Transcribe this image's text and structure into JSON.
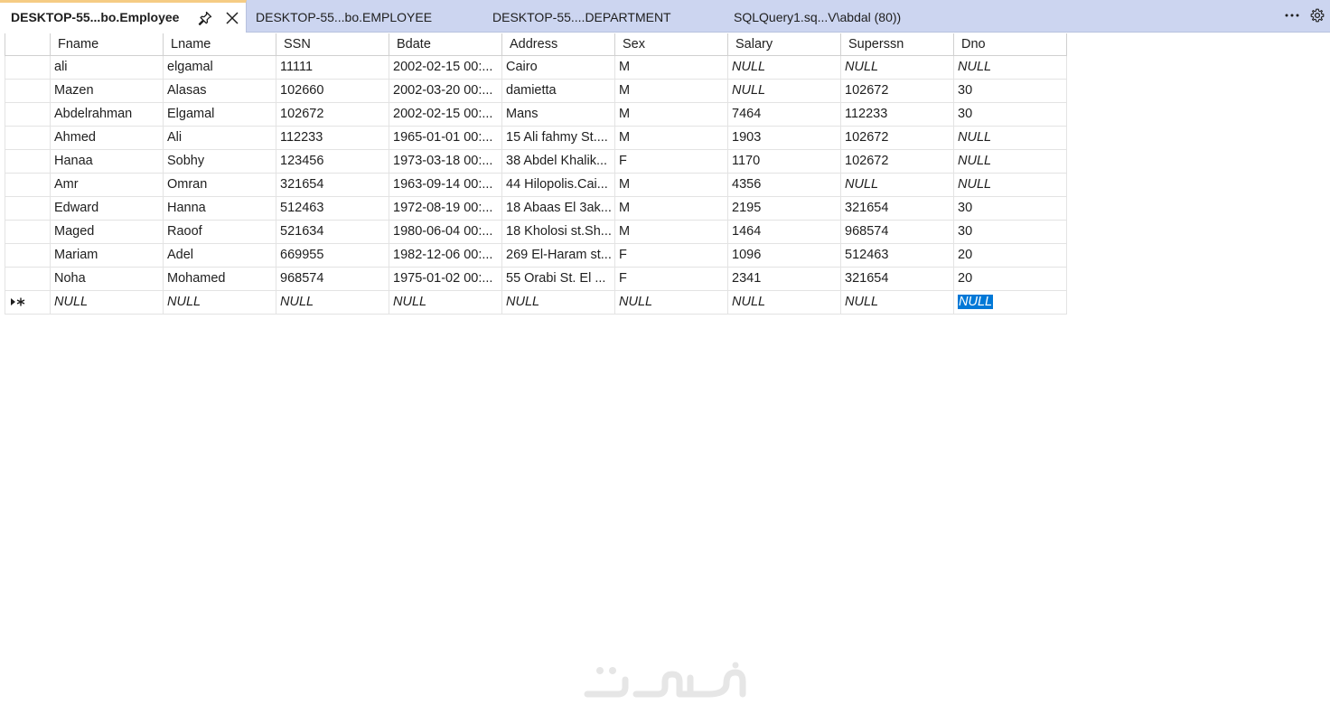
{
  "tabs": [
    {
      "label": "DESKTOP-55...bo.Employee",
      "active": true
    },
    {
      "label": "DESKTOP-55...bo.EMPLOYEE",
      "active": false
    },
    {
      "label": "DESKTOP-55....DEPARTMENT",
      "active": false
    },
    {
      "label": "SQLQuery1.sq...V\\abdal (80))",
      "active": false
    }
  ],
  "tab_actions": {
    "pin_icon": "pin-icon",
    "close_icon": "close-icon",
    "more_icon": "more-icon",
    "settings_icon": "gear-icon"
  },
  "grid": {
    "columns": [
      "Fname",
      "Lname",
      "SSN",
      "Bdate",
      "Address",
      "Sex",
      "Salary",
      "Superssn",
      "Dno"
    ],
    "rows": [
      [
        "ali",
        "elgamal",
        "11111",
        "2002-02-15 00:...",
        "Cairo",
        "M",
        "NULL",
        "NULL",
        "NULL"
      ],
      [
        "Mazen",
        "Alasas",
        "102660",
        "2002-03-20 00:...",
        "damietta",
        "M",
        "NULL",
        "102672",
        "30"
      ],
      [
        "Abdelrahman",
        "Elgamal",
        "102672",
        "2002-02-15 00:...",
        "Mans",
        "M",
        "7464",
        "112233",
        "30"
      ],
      [
        "Ahmed",
        "Ali",
        "112233",
        "1965-01-01 00:...",
        "15 Ali fahmy St....",
        "M",
        "1903",
        "102672",
        "NULL"
      ],
      [
        "Hanaa",
        "Sobhy",
        "123456",
        "1973-03-18 00:...",
        "38 Abdel Khalik...",
        "F",
        "1170",
        "102672",
        "NULL"
      ],
      [
        "Amr",
        "Omran",
        "321654",
        "1963-09-14 00:...",
        "44 Hilopolis.Cai...",
        "M",
        "4356",
        "NULL",
        "NULL"
      ],
      [
        "Edward",
        "Hanna",
        "512463",
        "1972-08-19 00:...",
        "18 Abaas El 3ak...",
        "M",
        "2195",
        "321654",
        "30"
      ],
      [
        "Maged",
        "Raoof",
        "521634",
        "1980-06-04 00:...",
        "18 Kholosi st.Sh...",
        "M",
        "1464",
        "968574",
        "30"
      ],
      [
        "Mariam",
        "Adel",
        "669955",
        "1982-12-06 00:...",
        "269 El-Haram st...",
        "F",
        "1096",
        "512463",
        "20"
      ],
      [
        "Noha",
        "Mohamed",
        "968574",
        "1975-01-02 00:...",
        "55 Orabi St. El ...",
        "F",
        "2341",
        "321654",
        "20"
      ]
    ],
    "new_row": [
      "NULL",
      "NULL",
      "NULL",
      "NULL",
      "NULL",
      "NULL",
      "NULL",
      "NULL",
      "NULL"
    ],
    "new_row_indicator": "new-row-indicator-icon",
    "selected_cell": {
      "row": "new",
      "column": "Dno"
    },
    "null_text": "NULL"
  },
  "watermark": {
    "icon": "watermark-logo",
    "color": "#e4e4e4"
  },
  "colors": {
    "tabbar": "#ccd5f0",
    "active_tab_accent": "#f5cc84",
    "selection": "#0078d7"
  }
}
